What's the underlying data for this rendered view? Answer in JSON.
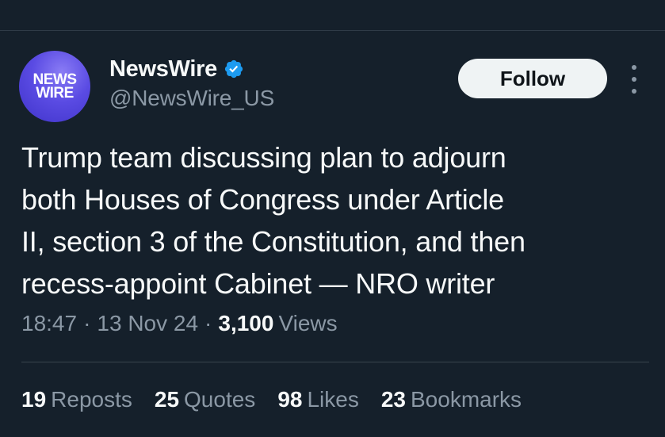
{
  "account": {
    "avatar_line1": "NEWS",
    "avatar_line2": "WIRE",
    "display_name": "NewsWire",
    "handle": "@NewsWire_US",
    "verified_icon": "verified-badge-icon",
    "verified_color": "#1d9bf0"
  },
  "actions": {
    "follow_label": "Follow",
    "more_icon": "more-vertical-icon"
  },
  "tweet": {
    "lines": [
      "Trump team discussing plan to adjourn",
      "both Houses of Congress under Article",
      "II, section 3 of the Constitution, and then",
      "recess-appoint Cabinet — NRO writer"
    ],
    "time": "18:47",
    "date": "13 Nov 24",
    "separator": "·",
    "views_count": "3,100",
    "views_label": "Views"
  },
  "stats": [
    {
      "count": "19",
      "label": "Reposts"
    },
    {
      "count": "25",
      "label": "Quotes"
    },
    {
      "count": "98",
      "label": "Likes"
    },
    {
      "count": "23",
      "label": "Bookmarks"
    }
  ],
  "colors": {
    "background": "#15202b",
    "text_primary": "#f7f9f9",
    "text_secondary": "#8b98a5",
    "follow_bg": "#eff3f4",
    "avatar_brand": "#5a4be3"
  }
}
